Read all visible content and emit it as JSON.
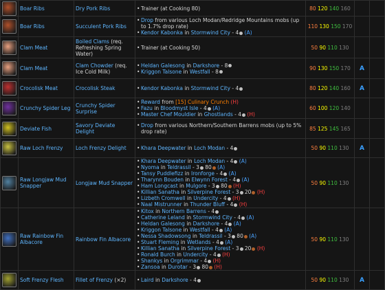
{
  "rows": [
    {
      "icon": "boar-ribs-icon",
      "icon_color": "#b0502a",
      "ing": "Boar Ribs",
      "food": "Dry Pork Ribs",
      "food_note": "",
      "sources": [
        {
          "parts": [
            {
              "t": "Trainer (at Cooking 80)",
              "c": "plain"
            }
          ]
        }
      ],
      "skill": [
        "80",
        "120",
        "140",
        "160"
      ],
      "fac": ""
    },
    {
      "icon": "boar-ribs-icon",
      "icon_color": "#b0502a",
      "ing": "Boar Ribs",
      "food": "Succulent Pork Ribs",
      "food_note": "",
      "sources": [
        {
          "parts": [
            {
              "t": "Drop",
              "c": "link"
            },
            {
              "t": " from various Loch Modan/Redridge Mountains mobs (up to 1.7% drop rate)",
              "c": "plain"
            }
          ]
        },
        {
          "parts": [
            {
              "t": "Kendor Kabonka",
              "c": "link"
            },
            {
              "t": " in ",
              "c": "plain"
            },
            {
              "t": "Stormwind City",
              "c": "link"
            },
            {
              "t": " - 4",
              "c": "plain"
            },
            {
              "t": "coin",
              "c": "silver"
            },
            {
              "t": " (A)",
              "c": "alliance"
            }
          ]
        }
      ],
      "skill": [
        "110",
        "130",
        "150",
        "170"
      ],
      "fac": ""
    },
    {
      "icon": "clam-meat-icon",
      "icon_color": "#e8a080",
      "ing": "Clam Meat",
      "food": "Boiled Clams",
      "food_note": "(req. Refreshing Spring Water)",
      "sources": [
        {
          "parts": [
            {
              "t": "Trainer (at Cooking 50)",
              "c": "plain"
            }
          ]
        }
      ],
      "skill": [
        "50",
        "90",
        "110",
        "130"
      ],
      "fac": ""
    },
    {
      "icon": "clam-meat-icon",
      "icon_color": "#e8a080",
      "ing": "Clam Meat",
      "food": "Clam Chowder",
      "food_note": "(req. Ice Cold Milk)",
      "sources": [
        {
          "parts": [
            {
              "t": "Heldan Galesong",
              "c": "link"
            },
            {
              "t": " in ",
              "c": "plain"
            },
            {
              "t": "Darkshore",
              "c": "link"
            },
            {
              "t": " - 8",
              "c": "plain"
            },
            {
              "t": "coin",
              "c": "silver"
            }
          ]
        },
        {
          "parts": [
            {
              "t": "Kriggon Talsone",
              "c": "link"
            },
            {
              "t": " in ",
              "c": "plain"
            },
            {
              "t": "Westfall",
              "c": "link"
            },
            {
              "t": " - 8",
              "c": "plain"
            },
            {
              "t": "coin",
              "c": "silver"
            }
          ]
        }
      ],
      "skill": [
        "90",
        "130",
        "150",
        "170"
      ],
      "fac": "A"
    },
    {
      "icon": "crocolisk-meat-icon",
      "icon_color": "#c03030",
      "ing": "Crocolisk Meat",
      "food": "Crocolisk Steak",
      "food_note": "",
      "sources": [
        {
          "parts": [
            {
              "t": "Kendor Kabonka",
              "c": "link"
            },
            {
              "t": " in ",
              "c": "plain"
            },
            {
              "t": "Stormwind City",
              "c": "link"
            },
            {
              "t": " - 4",
              "c": "plain"
            },
            {
              "t": "coin",
              "c": "silver"
            }
          ]
        }
      ],
      "skill": [
        "80",
        "120",
        "140",
        "160"
      ],
      "fac": "A"
    },
    {
      "icon": "spider-leg-icon",
      "icon_color": "#7030a0",
      "ing": "Crunchy Spider Leg",
      "food": "Crunchy Spider Surprise",
      "food_note": "",
      "sources": [
        {
          "parts": [
            {
              "t": "Reward",
              "c": "link"
            },
            {
              "t": " from ",
              "c": "plain"
            },
            {
              "t": "[15] Culinary Crunch",
              "c": "quest"
            },
            {
              "t": " (H)",
              "c": "horde"
            }
          ]
        },
        {
          "parts": [
            {
              "t": "Fazu",
              "c": "link"
            },
            {
              "t": " in ",
              "c": "plain"
            },
            {
              "t": "Bloodmyst Isle",
              "c": "link"
            },
            {
              "t": " - 4",
              "c": "plain"
            },
            {
              "t": "coin",
              "c": "silver"
            },
            {
              "t": " (A)",
              "c": "alliance"
            }
          ]
        },
        {
          "parts": [
            {
              "t": "Master Chef Mouldier",
              "c": "link"
            },
            {
              "t": " in ",
              "c": "plain"
            },
            {
              "t": "Ghostlands",
              "c": "link"
            },
            {
              "t": " - 4",
              "c": "plain"
            },
            {
              "t": "coin",
              "c": "silver"
            },
            {
              "t": " (H)",
              "c": "horde"
            }
          ]
        }
      ],
      "skill": [
        "60",
        "100",
        "120",
        "140"
      ],
      "fac": ""
    },
    {
      "icon": "deviate-fish-icon",
      "icon_color": "#d0c020",
      "ing": "Deviate Fish",
      "food": "Savory Deviate Delight",
      "food_note": "",
      "sources": [
        {
          "parts": [
            {
              "t": "Drop",
              "c": "link"
            },
            {
              "t": " from various Northern/Southern Barrens mobs (up to 5% drop rate)",
              "c": "plain"
            }
          ]
        }
      ],
      "skill": [
        "85",
        "125",
        "145",
        "165"
      ],
      "fac": ""
    },
    {
      "icon": "loch-frenzy-icon",
      "icon_color": "#c8c040",
      "ing": "Raw Loch Frenzy",
      "food": "Loch Frenzy Delight",
      "food_note": "",
      "sources": [
        {
          "parts": [
            {
              "t": "Khara Deepwater",
              "c": "link"
            },
            {
              "t": " in ",
              "c": "plain"
            },
            {
              "t": "Loch Modan",
              "c": "link"
            },
            {
              "t": " - 4",
              "c": "plain"
            },
            {
              "t": "coin",
              "c": "silver"
            }
          ]
        }
      ],
      "skill": [
        "50",
        "90",
        "110",
        "130"
      ],
      "fac": "A"
    },
    {
      "icon": "mud-snapper-icon",
      "icon_color": "#5080a0",
      "ing": "Raw Longjaw Mud Snapper",
      "food": "Longjaw Mud Snapper",
      "food_note": "",
      "sources": [
        {
          "parts": [
            {
              "t": "Khara Deepwater",
              "c": "link"
            },
            {
              "t": " in ",
              "c": "plain"
            },
            {
              "t": "Loch Modan",
              "c": "link"
            },
            {
              "t": " - 4",
              "c": "plain"
            },
            {
              "t": "coin",
              "c": "silver"
            },
            {
              "t": " (A)",
              "c": "alliance"
            }
          ]
        },
        {
          "parts": [
            {
              "t": "Nyoma",
              "c": "link"
            },
            {
              "t": " in ",
              "c": "plain"
            },
            {
              "t": "Teldrassil",
              "c": "link"
            },
            {
              "t": " - 3",
              "c": "plain"
            },
            {
              "t": "coin",
              "c": "silver"
            },
            {
              "t": " 80",
              "c": "plain"
            },
            {
              "t": "coin",
              "c": "copper"
            },
            {
              "t": " (A)",
              "c": "alliance"
            }
          ]
        },
        {
          "parts": [
            {
              "t": "Tansy Puddlefizz",
              "c": "link"
            },
            {
              "t": " in ",
              "c": "plain"
            },
            {
              "t": "Ironforge",
              "c": "link"
            },
            {
              "t": " - 4",
              "c": "plain"
            },
            {
              "t": "coin",
              "c": "silver"
            },
            {
              "t": " (A)",
              "c": "alliance"
            }
          ]
        },
        {
          "parts": [
            {
              "t": "Tharynn Bouden",
              "c": "link"
            },
            {
              "t": " in ",
              "c": "plain"
            },
            {
              "t": "Elwynn Forest",
              "c": "link"
            },
            {
              "t": " - 4",
              "c": "plain"
            },
            {
              "t": "coin",
              "c": "silver"
            },
            {
              "t": " (A)",
              "c": "alliance"
            }
          ]
        },
        {
          "parts": [
            {
              "t": "Ham Longcast",
              "c": "link"
            },
            {
              "t": " in ",
              "c": "plain"
            },
            {
              "t": "Mulgore",
              "c": "link"
            },
            {
              "t": " - 3",
              "c": "plain"
            },
            {
              "t": "coin",
              "c": "silver"
            },
            {
              "t": " 80",
              "c": "plain"
            },
            {
              "t": "coin",
              "c": "copper"
            },
            {
              "t": " (H)",
              "c": "horde"
            }
          ]
        },
        {
          "parts": [
            {
              "t": "Killian Sanatha",
              "c": "link"
            },
            {
              "t": " in ",
              "c": "plain"
            },
            {
              "t": "Silverpine Forest",
              "c": "link"
            },
            {
              "t": " - 3",
              "c": "plain"
            },
            {
              "t": "coin",
              "c": "silver"
            },
            {
              "t": " 20",
              "c": "plain"
            },
            {
              "t": "coin",
              "c": "copper"
            },
            {
              "t": " (H)",
              "c": "horde"
            }
          ]
        },
        {
          "parts": [
            {
              "t": "Lizbeth Cromwell",
              "c": "link"
            },
            {
              "t": " in ",
              "c": "plain"
            },
            {
              "t": "Undercity",
              "c": "link"
            },
            {
              "t": " - 4",
              "c": "plain"
            },
            {
              "t": "coin",
              "c": "silver"
            },
            {
              "t": " (H)",
              "c": "horde"
            }
          ]
        },
        {
          "parts": [
            {
              "t": "Naal Mistrunner",
              "c": "link"
            },
            {
              "t": " in ",
              "c": "plain"
            },
            {
              "t": "Thunder Bluff",
              "c": "link"
            },
            {
              "t": " - 4",
              "c": "plain"
            },
            {
              "t": "coin",
              "c": "silver"
            },
            {
              "t": " (H)",
              "c": "horde"
            }
          ]
        }
      ],
      "skill": [
        "50",
        "90",
        "110",
        "130"
      ],
      "fac": ""
    },
    {
      "icon": "rainbow-fin-icon",
      "icon_color": "#4070c0",
      "ing": "Raw Rainbow Fin Albacore",
      "food": "Rainbow Fin Albacore",
      "food_note": "",
      "sources": [
        {
          "parts": [
            {
              "t": "Kitox",
              "c": "link"
            },
            {
              "t": " in ",
              "c": "plain"
            },
            {
              "t": "Northern Barrens",
              "c": "link"
            },
            {
              "t": " - 4",
              "c": "plain"
            },
            {
              "t": "coin",
              "c": "silver"
            }
          ]
        },
        {
          "parts": [
            {
              "t": "Catherine Leland",
              "c": "link"
            },
            {
              "t": " in ",
              "c": "plain"
            },
            {
              "t": "Stormwind City",
              "c": "link"
            },
            {
              "t": " - 4",
              "c": "plain"
            },
            {
              "t": "coin",
              "c": "silver"
            },
            {
              "t": " (A)",
              "c": "alliance"
            }
          ]
        },
        {
          "parts": [
            {
              "t": "Heldan Galesong",
              "c": "link"
            },
            {
              "t": " in ",
              "c": "plain"
            },
            {
              "t": "Darkshore",
              "c": "link"
            },
            {
              "t": " - 4",
              "c": "plain"
            },
            {
              "t": "coin",
              "c": "silver"
            },
            {
              "t": " (A)",
              "c": "alliance"
            }
          ]
        },
        {
          "parts": [
            {
              "t": "Kriggon Talsone",
              "c": "link"
            },
            {
              "t": " in ",
              "c": "plain"
            },
            {
              "t": "Westfall",
              "c": "link"
            },
            {
              "t": " - 4",
              "c": "plain"
            },
            {
              "t": "coin",
              "c": "silver"
            },
            {
              "t": " (A)",
              "c": "alliance"
            }
          ]
        },
        {
          "parts": [
            {
              "t": "Nessa Shadowsong",
              "c": "link"
            },
            {
              "t": " in ",
              "c": "plain"
            },
            {
              "t": "Teldrassil",
              "c": "link"
            },
            {
              "t": " - 3",
              "c": "plain"
            },
            {
              "t": "coin",
              "c": "silver"
            },
            {
              "t": " 80",
              "c": "plain"
            },
            {
              "t": "coin",
              "c": "copper"
            },
            {
              "t": " (A)",
              "c": "alliance"
            }
          ]
        },
        {
          "parts": [
            {
              "t": "Stuart Fleming",
              "c": "link"
            },
            {
              "t": " in ",
              "c": "plain"
            },
            {
              "t": "Wetlands",
              "c": "link"
            },
            {
              "t": " - 4",
              "c": "plain"
            },
            {
              "t": "coin",
              "c": "silver"
            },
            {
              "t": " (A)",
              "c": "alliance"
            }
          ]
        },
        {
          "parts": [
            {
              "t": "Killian Sanatha",
              "c": "link"
            },
            {
              "t": " in ",
              "c": "plain"
            },
            {
              "t": "Silverpine Forest",
              "c": "link"
            },
            {
              "t": " - 3",
              "c": "plain"
            },
            {
              "t": "coin",
              "c": "silver"
            },
            {
              "t": " 20",
              "c": "plain"
            },
            {
              "t": "coin",
              "c": "copper"
            },
            {
              "t": " (H)",
              "c": "horde"
            }
          ]
        },
        {
          "parts": [
            {
              "t": "Ronald Burch",
              "c": "link"
            },
            {
              "t": " in ",
              "c": "plain"
            },
            {
              "t": "Undercity",
              "c": "link"
            },
            {
              "t": " - 4",
              "c": "plain"
            },
            {
              "t": "coin",
              "c": "silver"
            },
            {
              "t": " (H)",
              "c": "horde"
            }
          ]
        },
        {
          "parts": [
            {
              "t": "Shankys",
              "c": "link"
            },
            {
              "t": " in ",
              "c": "plain"
            },
            {
              "t": "Orgrimmar",
              "c": "link"
            },
            {
              "t": " - 4",
              "c": "plain"
            },
            {
              "t": "coin",
              "c": "silver"
            },
            {
              "t": " (H)",
              "c": "horde"
            }
          ]
        },
        {
          "parts": [
            {
              "t": "Zansoa",
              "c": "link"
            },
            {
              "t": " in ",
              "c": "plain"
            },
            {
              "t": "Durotar",
              "c": "link"
            },
            {
              "t": " - 3",
              "c": "plain"
            },
            {
              "t": "coin",
              "c": "silver"
            },
            {
              "t": " 80",
              "c": "plain"
            },
            {
              "t": "coin",
              "c": "copper"
            },
            {
              "t": " (H)",
              "c": "horde"
            }
          ]
        }
      ],
      "skill": [
        "50",
        "90",
        "110",
        "130"
      ],
      "fac": ""
    },
    {
      "icon": "soft-frenzy-icon",
      "icon_color": "#a0a030",
      "ing": "Soft Frenzy Flesh",
      "food": "Fillet of Frenzy",
      "food_note": "(×2)",
      "sources": [
        {
          "parts": [
            {
              "t": "Laird",
              "c": "link"
            },
            {
              "t": " in ",
              "c": "plain"
            },
            {
              "t": "Darkshore",
              "c": "link"
            },
            {
              "t": " - 4",
              "c": "plain"
            },
            {
              "t": "coin",
              "c": "silver"
            }
          ]
        }
      ],
      "skill": [
        "50",
        "90",
        "110",
        "130"
      ],
      "fac": "A"
    }
  ],
  "colors": {
    "orange": "#ff8040",
    "yellow": "#ffff00",
    "green": "#40c040",
    "gray": "#808080",
    "link": "#5fb6ff"
  }
}
